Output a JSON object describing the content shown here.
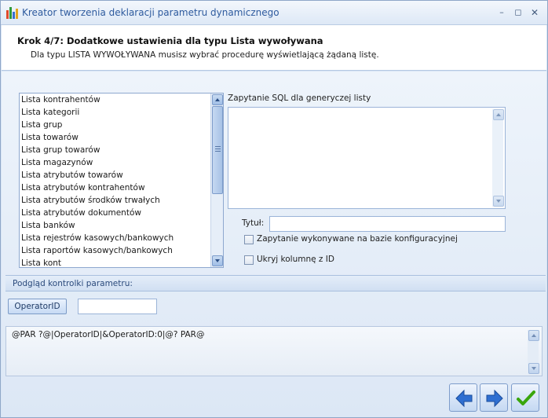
{
  "window": {
    "title": "Kreator tworzenia deklaracji parametru dynamicznego",
    "icon": "bar-chart-icon",
    "controls": [
      "minimize-icon",
      "maximize-icon",
      "close-icon"
    ]
  },
  "header": {
    "step_title": "Krok 4/7: Dodatkowe ustawienia dla typu Lista wywoływana",
    "step_description": "Dla typu LISTA WYWOŁYWANA musisz wybrać procedurę wyświetlającą żądaną listę."
  },
  "list": {
    "items": [
      "Lista kontrahentów",
      "Lista kategorii",
      "Lista grup",
      "Lista towarów",
      "Lista grup towarów",
      "Lista magazynów",
      "Lista atrybutów towarów",
      "Lista atrybutów kontrahentów",
      "Lista atrybutów środków trwałych",
      "Lista atrybutów dokumentów",
      "Lista banków",
      "Lista rejestrów kasowych/bankowych",
      "Lista raportów kasowych/bankowych",
      "Lista kont"
    ]
  },
  "sql": {
    "label": "Zapytanie SQL dla generyczej listy",
    "value": ""
  },
  "tytul": {
    "label": "Tytuł:",
    "value": ""
  },
  "options": {
    "config_db_label": "Zapytanie wykonywane na bazie konfiguracyjnej",
    "config_db_checked": false,
    "hide_id_label": "Ukryj kolumnę z ID",
    "hide_id_checked": false
  },
  "preview": {
    "section_label": "Podgląd kontrolki parametru:",
    "param_button_label": "OperatorID",
    "param_value": "",
    "expression": "@PAR ?@|OperatorID|&OperatorID:0|@? PAR@"
  },
  "nav": {
    "back_icon": "arrow-left-icon",
    "next_icon": "arrow-right-icon",
    "finish_icon": "checkmark-icon"
  },
  "colors": {
    "accent": "#2d5a9e",
    "arrow_blue": "#2f6fd1",
    "finish_green": "#3aa60c"
  }
}
